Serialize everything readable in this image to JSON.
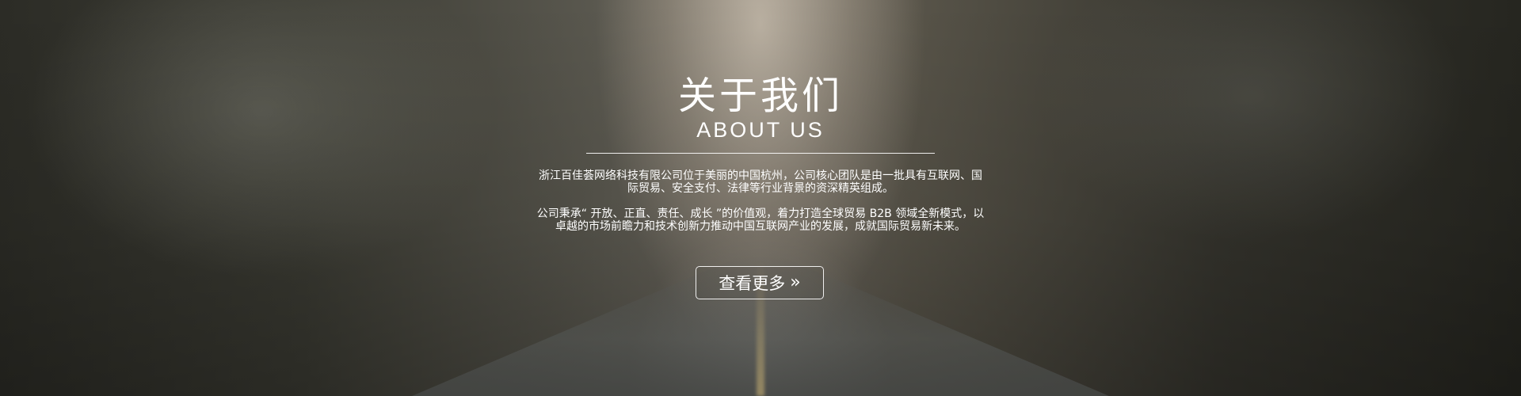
{
  "section": {
    "title": "关于我们",
    "subtitle": "ABOUT US",
    "paragraph_1": "浙江百佳荟网络科技有限公司位于美丽的中国杭州，公司核心团队是由一批具有互联网、国际贸易、安全支付、法律等行业背景的资深精英组成。",
    "paragraph_2": "公司秉承“ 开放、正直、责任、成长 ”的价值观，着力打造全球贸易 B2B 领域全新模式，以卓越的市场前瞻力和技术创新力推动中国互联网产业的发展，成就国际贸易新未来。",
    "more_button_label": "查看更多",
    "more_button_icon": "»"
  },
  "icons": {
    "more_button_icon_name": "double-chevron-right-icon"
  }
}
